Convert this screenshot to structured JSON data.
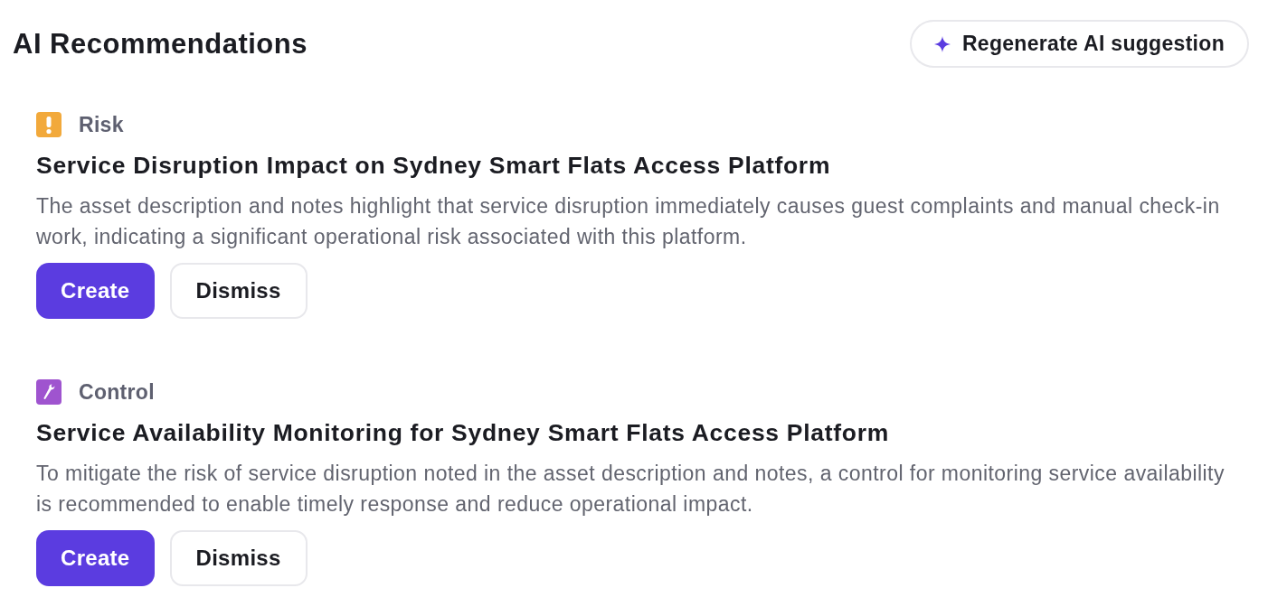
{
  "header": {
    "title": "AI Recommendations",
    "regenerate_button": "Regenerate AI suggestion"
  },
  "recommendations": [
    {
      "kind": "risk",
      "type_label": "Risk",
      "title": "Service Disruption Impact on Sydney Smart Flats Access Platform",
      "description": "The asset description and notes highlight that service disruption immediately causes guest complaints and manual check-in work, indicating a significant operational risk associated with this platform.",
      "actions": [
        {
          "kind": "primary",
          "label": "Create"
        },
        {
          "kind": "secondary",
          "label": "Dismiss"
        }
      ]
    },
    {
      "kind": "control",
      "type_label": "Control",
      "title": "Service Availability Monitoring for Sydney Smart Flats Access Platform",
      "description": "To mitigate the risk of service disruption noted in the asset description and notes, a control for monitoring service availability is recommended to enable timely response and reduce operational impact.",
      "actions": [
        {
          "kind": "primary",
          "label": "Create"
        },
        {
          "kind": "secondary",
          "label": "Dismiss"
        }
      ]
    }
  ]
}
